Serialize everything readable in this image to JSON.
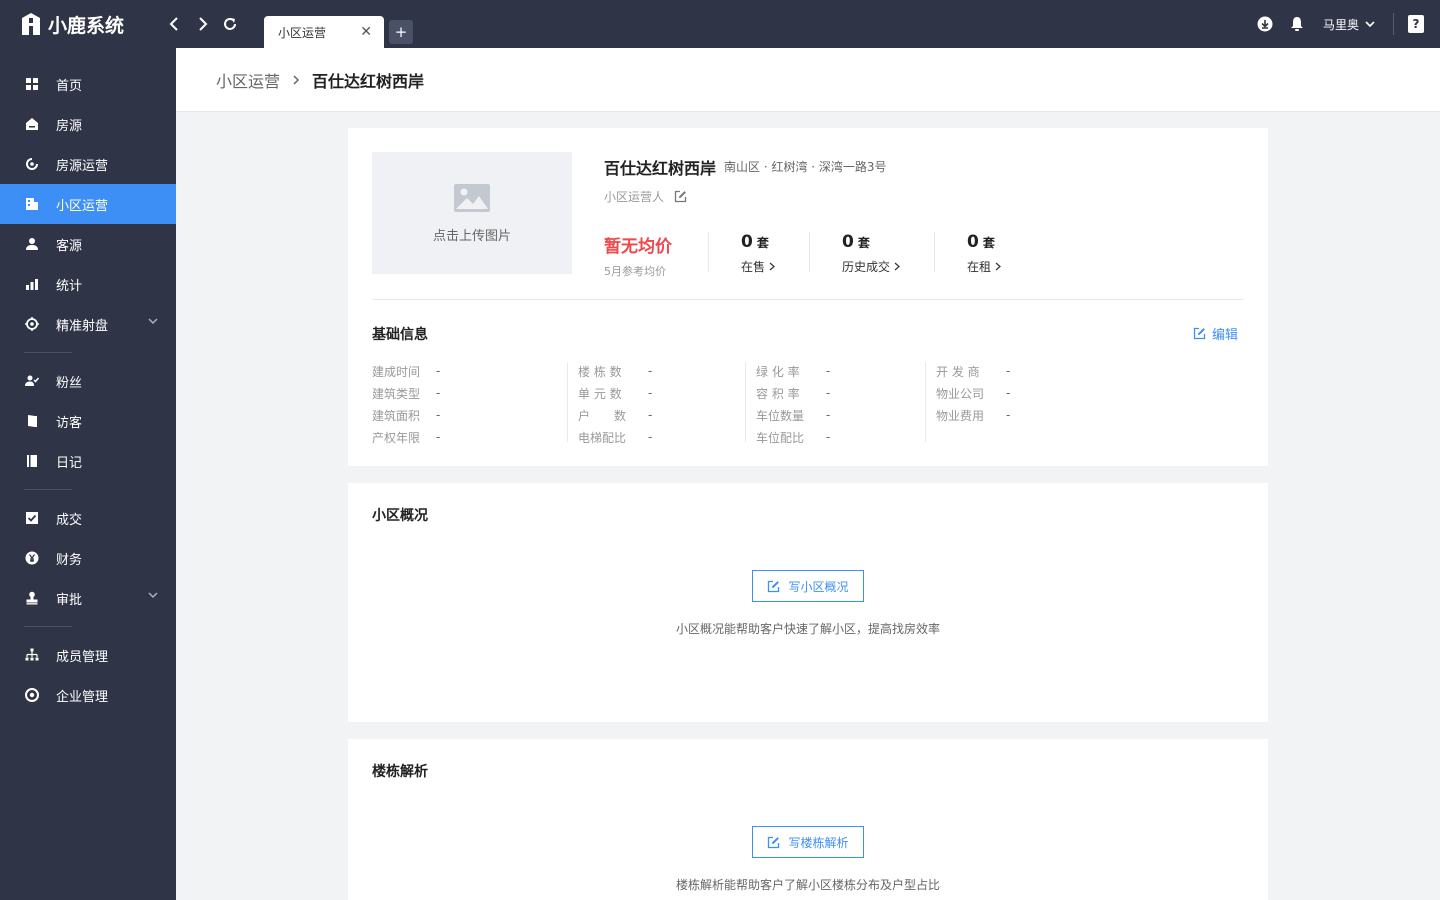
{
  "app": {
    "logo_text": "小鹿系统"
  },
  "tabs": [
    {
      "label": "小区运营"
    }
  ],
  "user": {
    "name": "马里奥"
  },
  "sidebar": {
    "items": [
      {
        "label": "首页",
        "icon": "grid-icon"
      },
      {
        "label": "房源",
        "icon": "house-icon"
      },
      {
        "label": "房源运营",
        "icon": "refresh-icon"
      },
      {
        "label": "小区运营",
        "icon": "building-icon",
        "active": true
      },
      {
        "label": "客源",
        "icon": "person-icon"
      },
      {
        "label": "统计",
        "icon": "bar-chart-icon"
      },
      {
        "label": "精准射盘",
        "icon": "target-icon",
        "expandable": true
      },
      {
        "label": "粉丝",
        "icon": "person-check-icon"
      },
      {
        "label": "访客",
        "icon": "door-icon"
      },
      {
        "label": "日记",
        "icon": "book-icon"
      },
      {
        "label": "成交",
        "icon": "checkbox-icon"
      },
      {
        "label": "财务",
        "icon": "yen-icon"
      },
      {
        "label": "审批",
        "icon": "stamp-icon",
        "expandable": true
      },
      {
        "label": "成员管理",
        "icon": "org-chart-icon"
      },
      {
        "label": "企业管理",
        "icon": "eye-icon"
      }
    ]
  },
  "breadcrumb": {
    "parent": "小区运营",
    "current": "百仕达红树西岸"
  },
  "community": {
    "upload_text": "点击上传图片",
    "name": "百仕达红树西岸",
    "address": "南山区 · 红树湾 · 深湾一路3号",
    "operator_label": "小区运营人",
    "price": {
      "value": "暂无均价",
      "label": "5月参考均价"
    },
    "stats": [
      {
        "value": "0",
        "unit": "套",
        "label": "在售"
      },
      {
        "value": "0",
        "unit": "套",
        "label": "历史成交"
      },
      {
        "value": "0",
        "unit": "套",
        "label": "在租"
      }
    ]
  },
  "basic_info": {
    "title": "基础信息",
    "edit_label": "编辑",
    "columns": [
      [
        {
          "label": "建成时间",
          "value": "-"
        },
        {
          "label": "建筑类型",
          "value": "-"
        },
        {
          "label": "建筑面积",
          "value": "-"
        },
        {
          "label": "产权年限",
          "value": "-"
        }
      ],
      [
        {
          "label": "楼 栋 数",
          "value": "-"
        },
        {
          "label": "单 元 数",
          "value": "-"
        },
        {
          "label": "户　　数",
          "value": "-"
        },
        {
          "label": "电梯配比",
          "value": "-"
        }
      ],
      [
        {
          "label": "绿 化 率",
          "value": "-"
        },
        {
          "label": "容 积 率",
          "value": "-"
        },
        {
          "label": "车位数量",
          "value": "-"
        },
        {
          "label": "车位配比",
          "value": "-"
        }
      ],
      [
        {
          "label": "开 发 商",
          "value": "-"
        },
        {
          "label": "物业公司",
          "value": "-"
        },
        {
          "label": "物业费用",
          "value": "-"
        }
      ]
    ]
  },
  "overview": {
    "title": "小区概况",
    "button": "写小区概况",
    "hint": "小区概况能帮助客户快速了解小区，提高找房效率"
  },
  "building": {
    "title": "楼栋解析",
    "button": "写楼栋解析",
    "hint": "楼栋解析能帮助客户了解小区楼栋分布及户型占比"
  },
  "colors": {
    "accent": "#3d8ff5",
    "sidebar_bg": "#2f3547",
    "price_red": "#f0474a"
  }
}
